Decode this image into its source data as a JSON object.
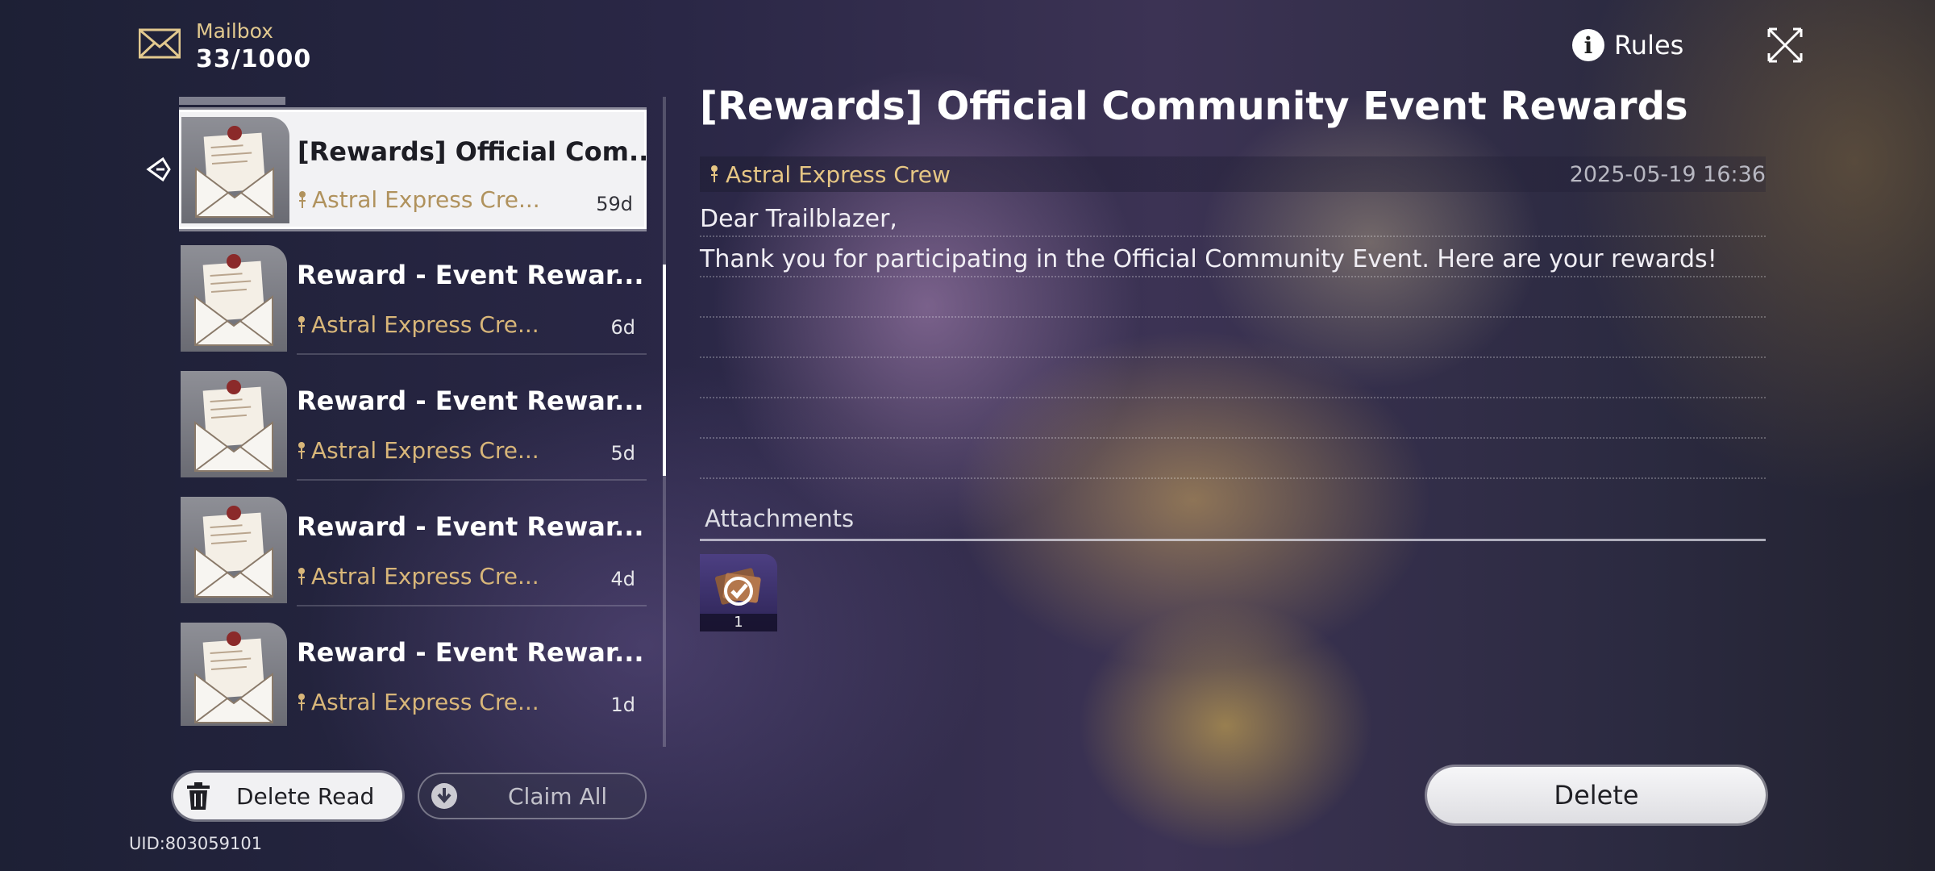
{
  "header": {
    "mailbox_label": "Mailbox",
    "mailbox_count": "33/1000",
    "rules_label": "Rules"
  },
  "mail_list": [
    {
      "title": "[Rewards] Official Com...",
      "sender": "Astral Express Cre...",
      "age": "59d",
      "selected": true
    },
    {
      "title": "Reward - Event Rewar...",
      "sender": "Astral Express Cre...",
      "age": "6d",
      "selected": false
    },
    {
      "title": "Reward - Event Rewar...",
      "sender": "Astral Express Cre...",
      "age": "5d",
      "selected": false
    },
    {
      "title": "Reward - Event Rewar...",
      "sender": "Astral Express Cre...",
      "age": "4d",
      "selected": false
    },
    {
      "title": "Reward - Event Rewar...",
      "sender": "Astral Express Cre...",
      "age": "1d",
      "selected": false
    }
  ],
  "actions": {
    "delete_read": "Delete Read",
    "claim_all": "Claim All",
    "delete": "Delete"
  },
  "uid": "UID:803059101",
  "detail": {
    "title": "[Rewards] Official Community Event Rewards",
    "sender": "Astral Express Crew",
    "date": "2025-05-19 16:36",
    "body_lines": [
      "Dear Trailblazer,",
      "Thank you for participating in the Official Community Event. Here are your rewards!",
      "",
      "",
      "",
      "",
      ""
    ],
    "attachments_label": "Attachments",
    "attachments": [
      {
        "icon": "reward-ticket-icon",
        "quantity": "1"
      }
    ]
  },
  "colors": {
    "gold_text": "#e2c98f",
    "sender_gold": "#d8b679",
    "selected_bg": "#f2f2f4"
  }
}
